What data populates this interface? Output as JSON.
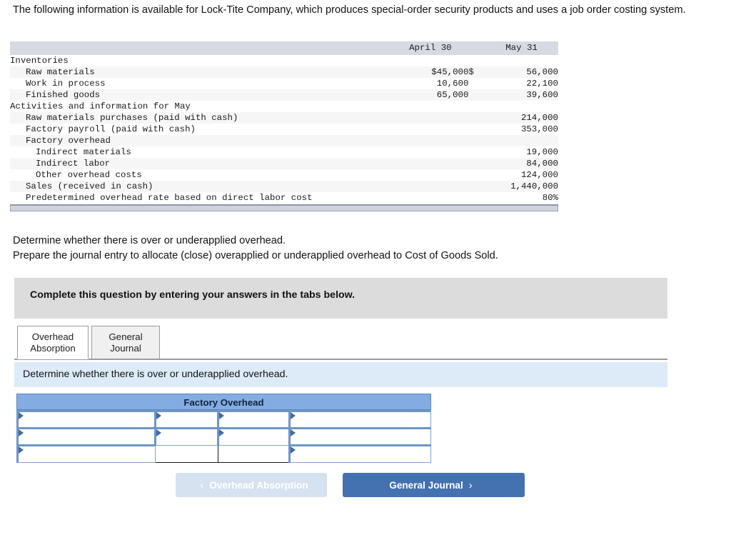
{
  "intro": {
    "paragraph": "The following information is available for Lock-Tite Company, which produces special-order security products and uses a job order costing system."
  },
  "data_table": {
    "headers": {
      "blank": "",
      "col1": "April 30",
      "dollar": "",
      "col2": "May 31"
    },
    "rows": [
      {
        "label": "Inventories",
        "indent": 0,
        "shade": false,
        "apr": "",
        "dollar": "",
        "may": ""
      },
      {
        "label": "Raw materials",
        "indent": 1,
        "shade": true,
        "apr": "$45,000",
        "dollar": "$",
        "may": "56,000"
      },
      {
        "label": "Work in process",
        "indent": 1,
        "shade": false,
        "apr": "10,600",
        "dollar": "",
        "may": "22,100"
      },
      {
        "label": "Finished goods",
        "indent": 1,
        "shade": true,
        "apr": "65,000",
        "dollar": "",
        "may": "39,600"
      },
      {
        "label": "Activities and information for May",
        "indent": 0,
        "shade": false,
        "apr": "",
        "dollar": "",
        "may": ""
      },
      {
        "label": "Raw materials purchases (paid with cash)",
        "indent": 1,
        "shade": true,
        "apr": "",
        "dollar": "",
        "may": "214,000"
      },
      {
        "label": "Factory payroll (paid with cash)",
        "indent": 1,
        "shade": false,
        "apr": "",
        "dollar": "",
        "may": "353,000"
      },
      {
        "label": "Factory overhead",
        "indent": 1,
        "shade": true,
        "apr": "",
        "dollar": "",
        "may": ""
      },
      {
        "label": "Indirect materials",
        "indent": 2,
        "shade": false,
        "apr": "",
        "dollar": "",
        "may": "19,000"
      },
      {
        "label": "Indirect labor",
        "indent": 2,
        "shade": true,
        "apr": "",
        "dollar": "",
        "may": "84,000"
      },
      {
        "label": "Other overhead costs",
        "indent": 2,
        "shade": false,
        "apr": "",
        "dollar": "",
        "may": "124,000"
      },
      {
        "label": "Sales (received in cash)",
        "indent": 1,
        "shade": true,
        "apr": "",
        "dollar": "",
        "may": "1,440,000"
      },
      {
        "label": "Predetermined overhead rate based on direct labor cost",
        "indent": 1,
        "shade": false,
        "apr": "",
        "dollar": "",
        "may": "80%"
      }
    ]
  },
  "requirements": {
    "line1": "Determine whether there is over or underapplied overhead.",
    "line2": "Prepare the journal entry to allocate (close) overapplied or underapplied overhead to Cost of Goods Sold."
  },
  "gray_banner": {
    "text": "Complete this question by entering your answers in the tabs below."
  },
  "tabs": [
    {
      "label_line1": "Overhead",
      "label_line2": "Absorption",
      "active": true
    },
    {
      "label_line1": "General",
      "label_line2": "Journal",
      "active": false
    }
  ],
  "blue_bar": {
    "text": "Determine whether there is over or underapplied overhead."
  },
  "taccount": {
    "title": "Factory Overhead",
    "rows": [
      {
        "cells": [
          "",
          "",
          "",
          ""
        ],
        "styles": [
          "marker",
          "marker",
          "marker",
          "marker"
        ]
      },
      {
        "cells": [
          "",
          "",
          "",
          ""
        ],
        "styles": [
          "marker",
          "marker",
          "marker",
          "marker"
        ]
      },
      {
        "cells": [
          "",
          "",
          "",
          ""
        ],
        "styles": [
          "marker",
          "plain",
          "plain",
          "marker"
        ]
      }
    ]
  },
  "nav": {
    "prev_label": "Overhead Absorption",
    "prev_chevron": "‹",
    "prev_disabled": true,
    "next_label": "General Journal",
    "next_chevron": "›"
  },
  "colors": {
    "table_header_bg": "#d6dae3",
    "table_stripe": "#f6f6f7",
    "gray_banner_bg": "#dcdcdc",
    "blue_bar_bg": "#ddeaf7",
    "taccount_header_bg": "#83ace2",
    "taccount_border": "#6e95c8",
    "next_button_bg": "#4472b0",
    "prev_button_bg": "#d6e2f0"
  }
}
